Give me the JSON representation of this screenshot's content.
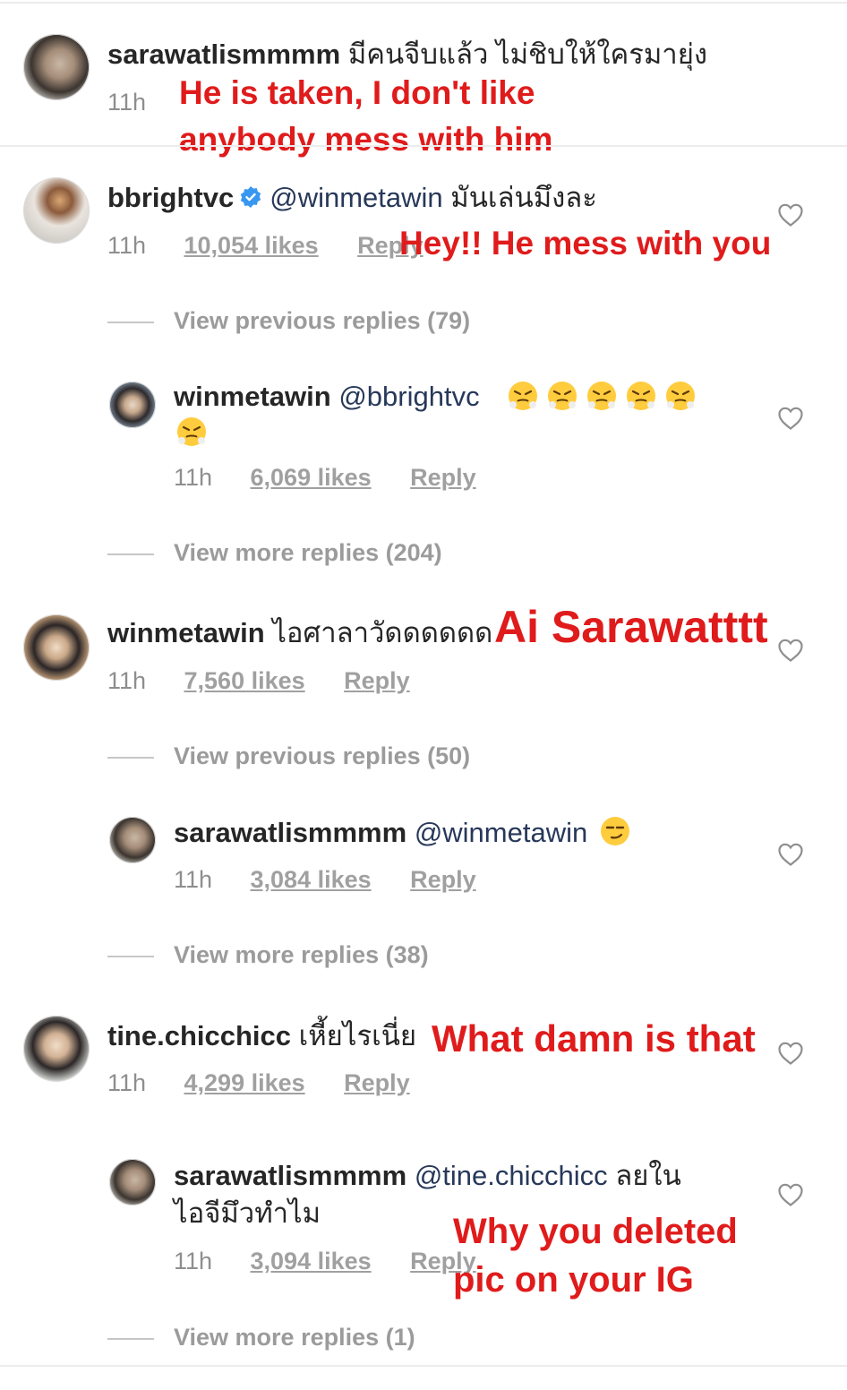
{
  "comments": [
    {
      "username": "sarawatlismmmm",
      "text": "มีคนจีบแล้ว ไม่ชิบให้ใครมายุ่ง",
      "time": "11h",
      "translation": [
        "He is taken, I don't like",
        "anybody mess with him"
      ]
    },
    {
      "username": "bbrightvc",
      "mention": "@winmetawin",
      "text": "มันเล่นมึงละ",
      "time": "11h",
      "likes": "10,054 likes",
      "reply": "Reply",
      "translation": "Hey!! He mess with you",
      "view_previous": "View previous replies (79)",
      "replies": [
        {
          "username": "winmetawin",
          "mention": "@bbrightvc",
          "emoji": "face-with-steam-emoji",
          "time": "11h",
          "likes": "6,069 likes",
          "reply": "Reply"
        }
      ],
      "view_more": "View more replies (204)"
    },
    {
      "username": "winmetawin",
      "text": "ไอศาลาวัดดดดดด",
      "time": "11h",
      "likes": "7,560 likes",
      "reply": "Reply",
      "translation": "Ai Sarawatttt",
      "view_previous": "View previous replies (50)",
      "replies": [
        {
          "username": "sarawatlismmmm",
          "mention": "@winmetawin",
          "emoji": "smirking-face-emoji",
          "time": "11h",
          "likes": "3,084 likes",
          "reply": "Reply"
        }
      ],
      "view_more": "View more replies (38)"
    },
    {
      "username": "tine.chicchicc",
      "text": "เหี้ยไรเนี่ย",
      "time": "11h",
      "likes": "4,299 likes",
      "reply": "Reply",
      "translation": "What damn is that",
      "replies": [
        {
          "username": "sarawatlismmmm",
          "mention": "@tine.chicchicc",
          "text": "ลยใน",
          "text2": "ไอจีมึวทำไม",
          "time": "11h",
          "likes": "3,094 likes",
          "reply": "Reply",
          "translation": [
            "Why you deleted",
            "pic on your IG"
          ]
        }
      ],
      "view_more": "View more replies (1)"
    }
  ],
  "colors": {
    "username": "#262626",
    "mention": "#27385a",
    "meta": "#8e8e8e",
    "translation": "#e01b1b",
    "verified": "#3897f0"
  }
}
